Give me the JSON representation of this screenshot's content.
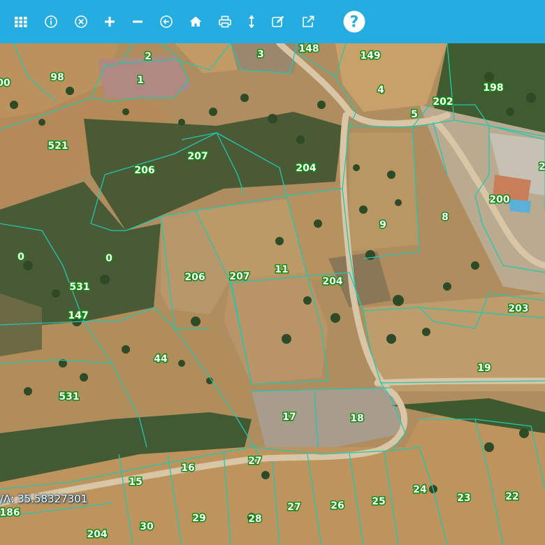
{
  "toolbar": {
    "background": "#25ace0",
    "buttons": [
      {
        "name": "layers-grid-button",
        "icon": "grid-icon"
      },
      {
        "name": "info-button",
        "icon": "info-icon"
      },
      {
        "name": "clear-button",
        "icon": "close-circle-icon"
      },
      {
        "name": "zoom-in-button",
        "icon": "plus-icon"
      },
      {
        "name": "zoom-out-button",
        "icon": "minus-icon"
      },
      {
        "name": "back-button",
        "icon": "arrow-left-circle-icon"
      },
      {
        "name": "home-button",
        "icon": "home-icon"
      },
      {
        "name": "print-button",
        "icon": "printer-icon"
      },
      {
        "name": "measure-button",
        "icon": "vertical-arrows-icon"
      },
      {
        "name": "edit-button",
        "icon": "edit-icon"
      },
      {
        "name": "external-link-button",
        "icon": "external-link-icon"
      },
      {
        "name": "help-button",
        "icon": "question-circle-icon"
      }
    ]
  },
  "map": {
    "parcel_line_color": "#22c7b0",
    "label_fill": "#ffffff",
    "label_stroke": "#118a11",
    "parcels": [
      "00",
      "98",
      "2",
      "1",
      "3",
      "148",
      "149",
      "4",
      "198",
      "202",
      "5",
      "521",
      "207",
      "206",
      "204",
      "2",
      "200",
      "9",
      "8",
      "0",
      "0",
      "531",
      "206",
      "207",
      "11",
      "204",
      "147",
      "203",
      "44",
      "19",
      "531",
      "17",
      "18",
      "27",
      "16",
      "15",
      "24",
      "23",
      "22",
      "186",
      "27",
      "26",
      "25",
      "29",
      "28",
      "30",
      "204"
    ]
  },
  "coordinate_readout": {
    "text": "/Λ: 35.58327301"
  }
}
